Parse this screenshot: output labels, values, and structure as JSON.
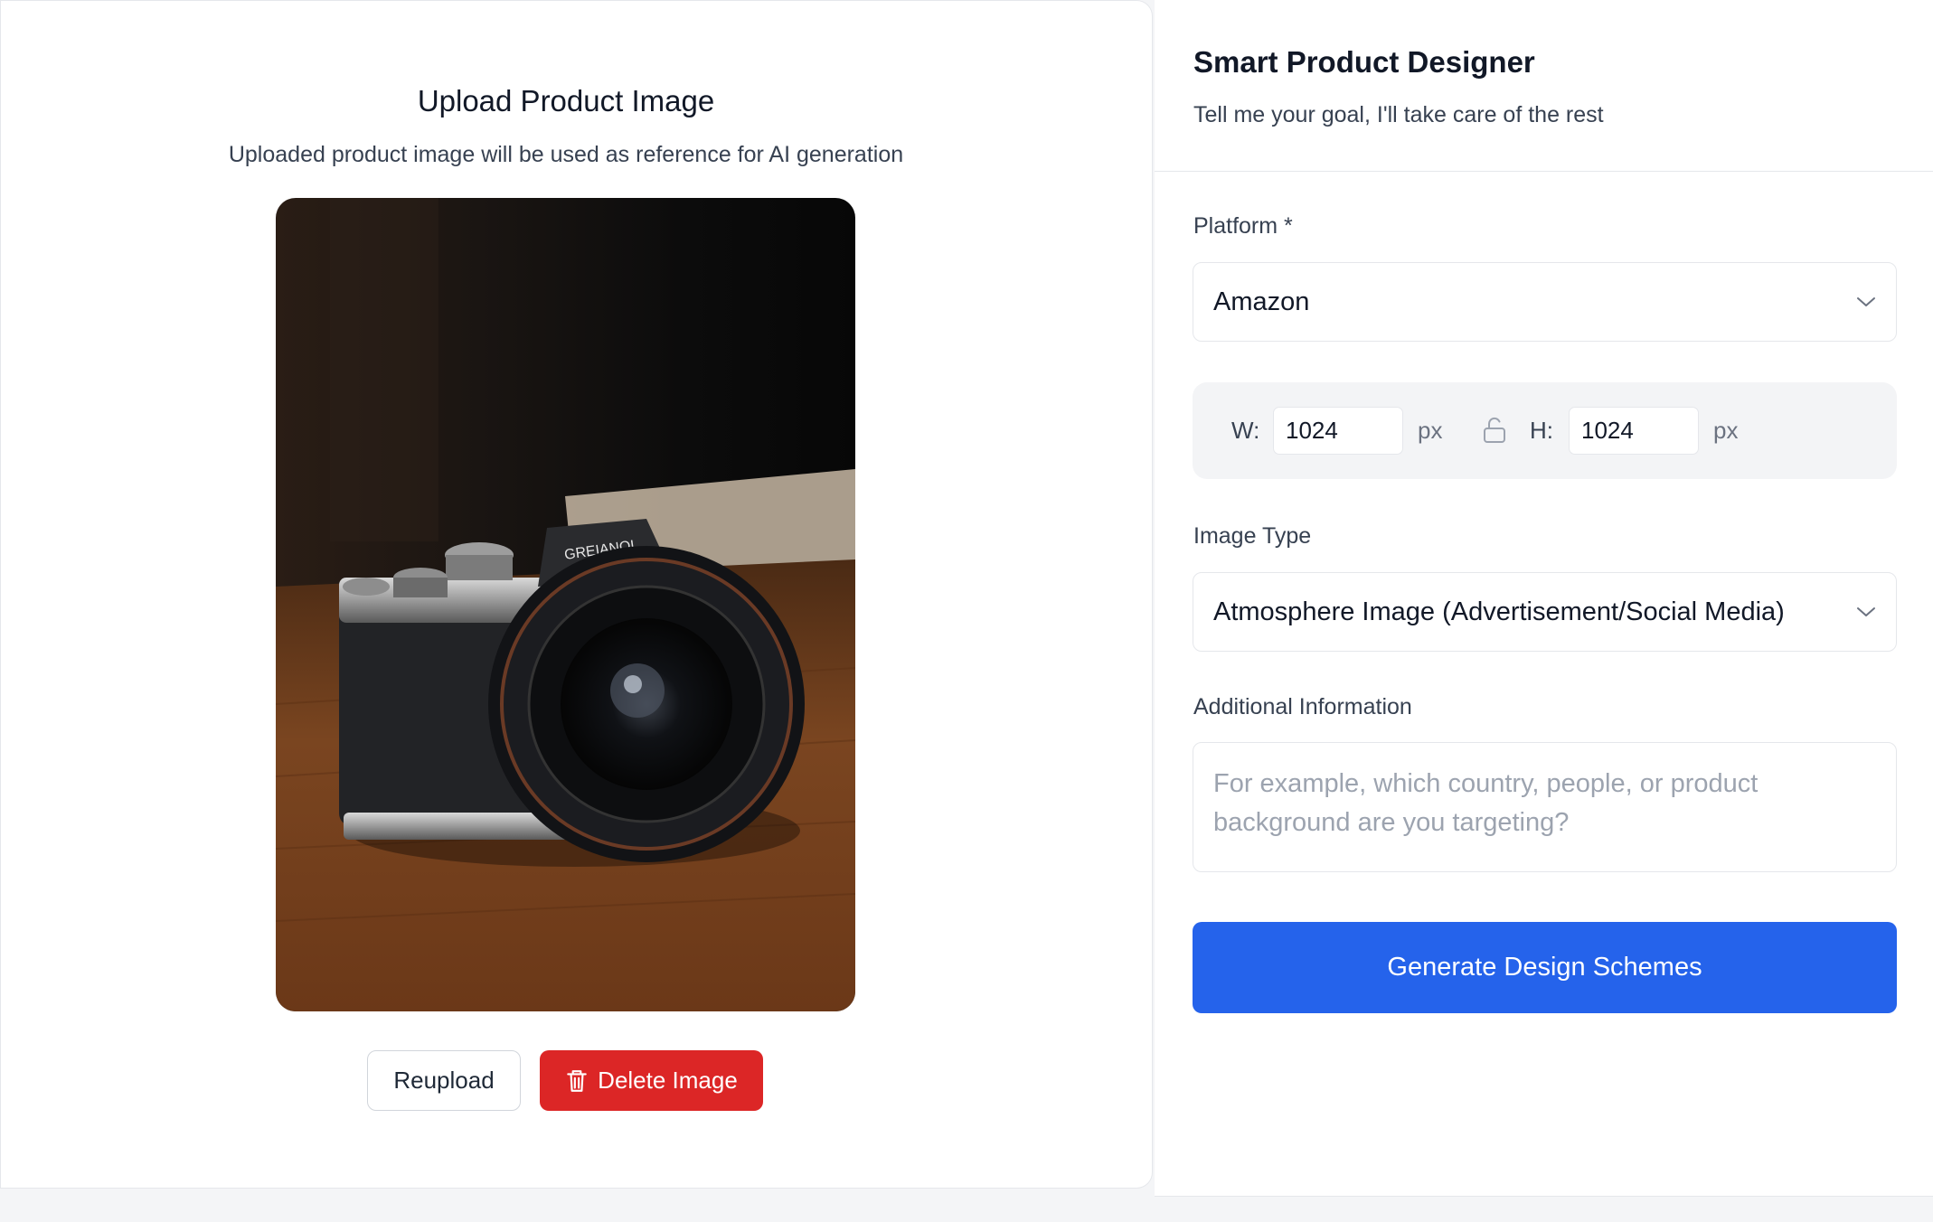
{
  "upload": {
    "title": "Upload Product Image",
    "subtitle": "Uploaded product image will be used as reference for AI generation",
    "image_alt": "Camera product photo",
    "reupload_label": "Reupload",
    "delete_label": "Delete Image"
  },
  "designer": {
    "title": "Smart Product Designer",
    "subtitle": "Tell me your goal, I'll take care of the rest"
  },
  "form": {
    "platform_label": "Platform *",
    "platform_value": "Amazon",
    "width_label": "W:",
    "width_value": "1024",
    "height_label": "H:",
    "height_value": "1024",
    "unit": "px",
    "image_type_label": "Image Type",
    "image_type_value": "Atmosphere Image (Advertisement/Social Media)",
    "additional_label": "Additional Information",
    "additional_placeholder": "For example, which country, people, or product background are you targeting?",
    "generate_label": "Generate Design Schemes"
  },
  "icons": {
    "chevron": "chevron-down-icon",
    "lock": "unlock-icon",
    "trash": "trash-icon"
  },
  "colors": {
    "primary": "#2563eb",
    "danger": "#dc2626",
    "border": "#e5e7eb",
    "muted_bg": "#f3f4f6"
  }
}
